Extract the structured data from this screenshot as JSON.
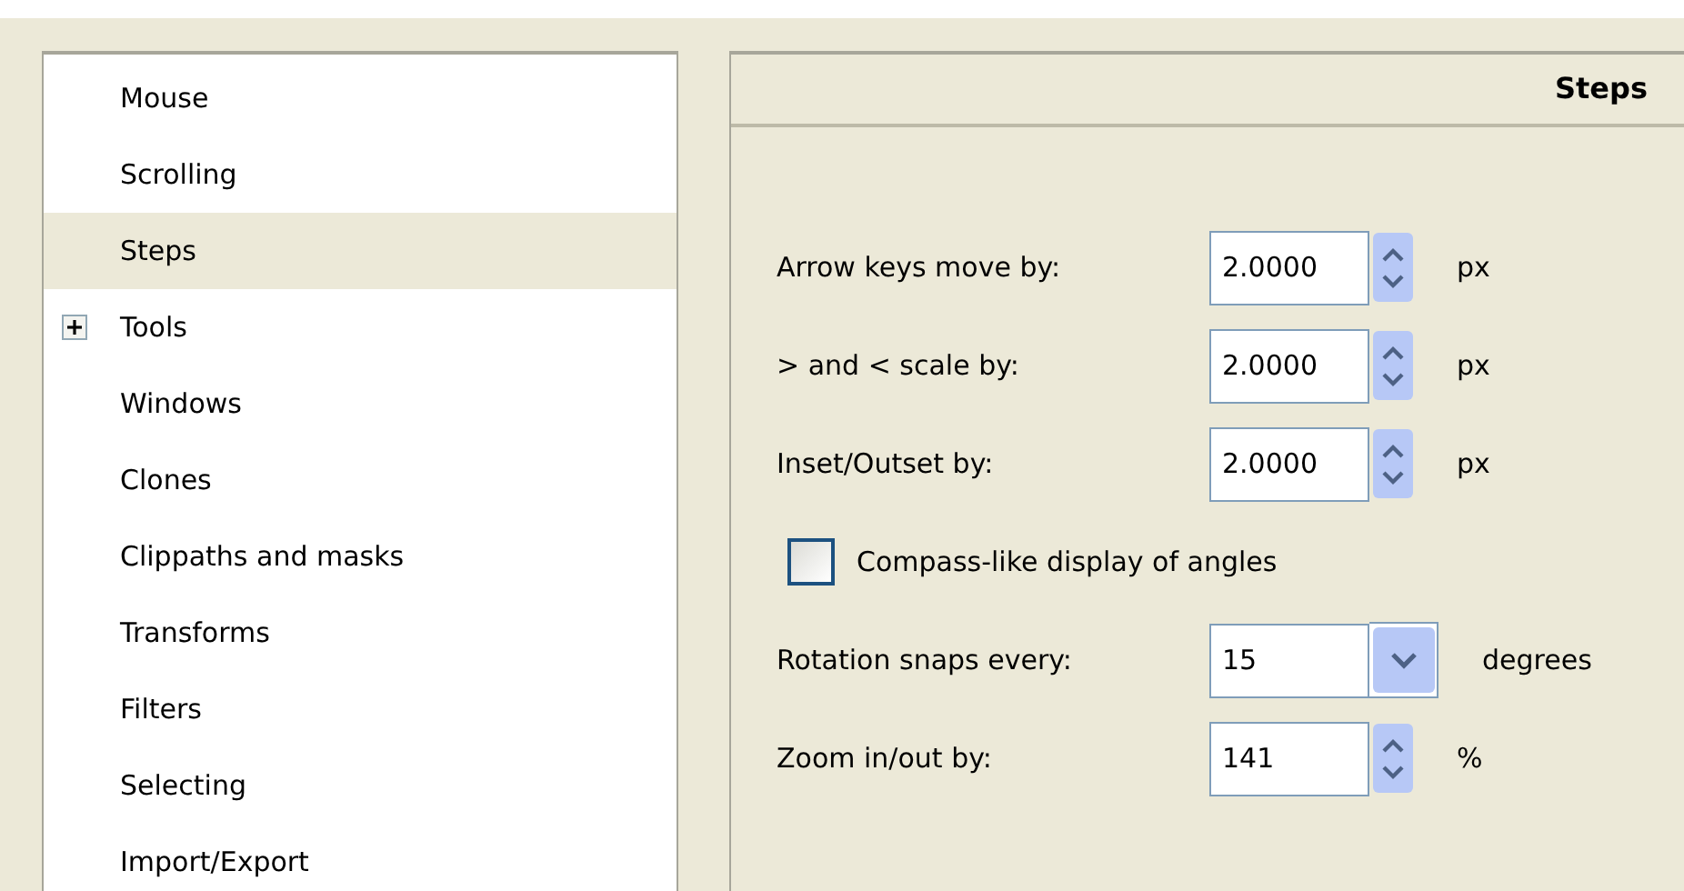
{
  "sidebar": {
    "items": [
      {
        "label": "Mouse",
        "kind": "leaf",
        "selected": false
      },
      {
        "label": "Scrolling",
        "kind": "leaf",
        "selected": false
      },
      {
        "label": "Steps",
        "kind": "leaf",
        "selected": true
      },
      {
        "label": "Tools",
        "kind": "group",
        "expanded": false,
        "selected": false
      },
      {
        "label": "Windows",
        "kind": "leaf",
        "selected": false
      },
      {
        "label": "Clones",
        "kind": "leaf",
        "selected": false
      },
      {
        "label": "Clippaths and masks",
        "kind": "leaf",
        "selected": false
      },
      {
        "label": "Transforms",
        "kind": "leaf",
        "selected": false
      },
      {
        "label": "Filters",
        "kind": "leaf",
        "selected": false
      },
      {
        "label": "Selecting",
        "kind": "leaf",
        "selected": false
      },
      {
        "label": "Import/Export",
        "kind": "leaf",
        "selected": false
      }
    ]
  },
  "panel": {
    "title": "Steps",
    "settings": [
      {
        "kind": "spin",
        "label": "Arrow keys move by:",
        "value": "2.0000",
        "unit": "px"
      },
      {
        "kind": "spin",
        "label": "> and < scale by:",
        "value": "2.0000",
        "unit": "px"
      },
      {
        "kind": "spin",
        "label": "Inset/Outset by:",
        "value": "2.0000",
        "unit": "px"
      },
      {
        "kind": "checkbox",
        "label": "Compass-like display of angles",
        "checked": false
      },
      {
        "kind": "combo",
        "label": "Rotation snaps every:",
        "value": "15",
        "unit": "degrees"
      },
      {
        "kind": "spin",
        "label": "Zoom in/out by:",
        "value": "141",
        "unit": "%"
      }
    ]
  }
}
